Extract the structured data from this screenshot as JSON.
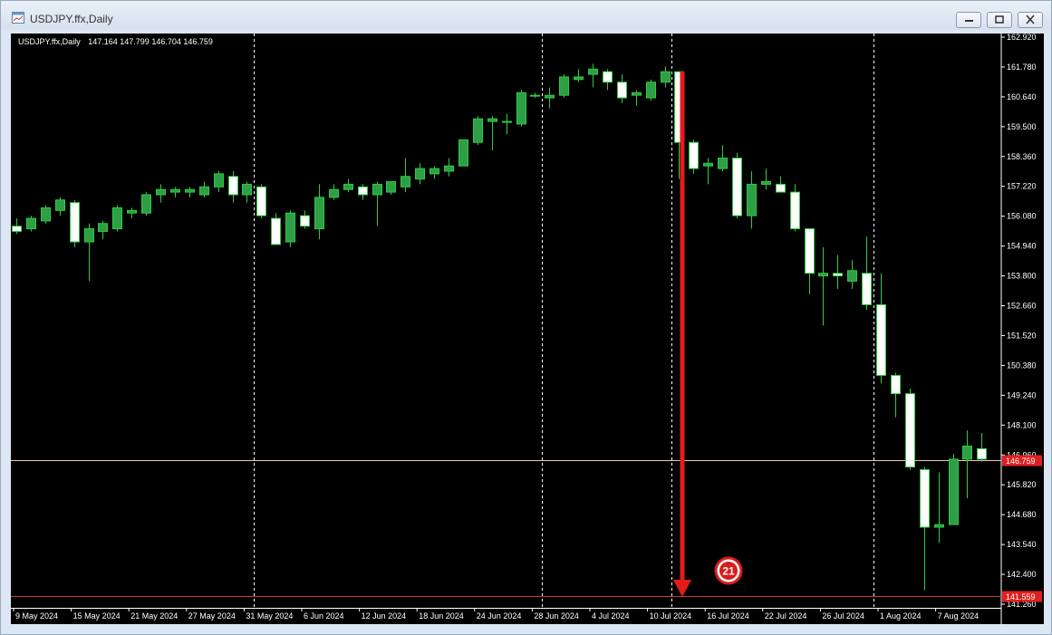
{
  "window": {
    "title": "USDJPY.ffx,Daily",
    "controls": {
      "minimize": "minimize",
      "restore": "restore",
      "close": "close"
    }
  },
  "chart_info": {
    "symbol": "USDJPY.ffx,Daily",
    "open": "147.164",
    "high": "147.799",
    "low": "146.704",
    "close": "146.759"
  },
  "price_labels": {
    "current_price": "146.759",
    "support_price": "141.559"
  },
  "annotation": {
    "badge": "21",
    "arrow_color": "#e31b1b"
  },
  "colors": {
    "background": "#000000",
    "bull_fill": "#2e9e47",
    "bear_fill": "#ffffff",
    "wick": "#2ecc40",
    "current_line": "#f5c1b6",
    "support_line": "#c43a2a",
    "price_tag": "#e02020"
  },
  "chart_data": {
    "type": "candlestick",
    "title": "",
    "xlabel": "",
    "ylabel": "",
    "ylim": [
      141.0,
      163.2
    ],
    "grid": false,
    "y_ticks": [
      "162.920",
      "161.780",
      "160.640",
      "159.500",
      "158.360",
      "157.220",
      "156.080",
      "154.940",
      "153.800",
      "152.660",
      "151.520",
      "150.380",
      "149.240",
      "148.100",
      "146.960",
      "145.820",
      "144.680",
      "143.540",
      "142.400",
      "141.260"
    ],
    "x_ticks": [
      "9 May 2024",
      "15 May 2024",
      "21 May 2024",
      "27 May 2024",
      "31 May 2024",
      "6 Jun 2024",
      "12 Jun 2024",
      "18 Jun 2024",
      "24 Jun 2024",
      "28 Jun 2024",
      "4 Jul 2024",
      "10 Jul 2024",
      "16 Jul 2024",
      "22 Jul 2024",
      "26 Jul 2024",
      "1 Aug 2024",
      "7 Aug 2024"
    ],
    "period_separators": [
      "31 May 2024",
      "28 Jun 2024",
      "10 Jul 2024",
      "1 Aug 2024"
    ],
    "horizontal_levels": [
      146.759,
      141.559
    ],
    "candles": [
      [
        155.7,
        156.0,
        155.4,
        155.5
      ],
      [
        155.6,
        156.1,
        155.5,
        156.0
      ],
      [
        155.9,
        156.5,
        155.8,
        156.4
      ],
      [
        156.3,
        156.8,
        156.1,
        156.7
      ],
      [
        156.6,
        156.7,
        154.9,
        155.1
      ],
      [
        155.1,
        155.8,
        153.6,
        155.6
      ],
      [
        155.5,
        155.9,
        155.2,
        155.8
      ],
      [
        155.6,
        156.5,
        155.5,
        156.4
      ],
      [
        156.2,
        156.4,
        156.0,
        156.3
      ],
      [
        156.2,
        157.0,
        156.1,
        156.9
      ],
      [
        156.9,
        157.3,
        156.6,
        157.1
      ],
      [
        157.0,
        157.2,
        156.8,
        157.1
      ],
      [
        157.0,
        157.2,
        156.8,
        157.1
      ],
      [
        156.9,
        157.4,
        156.8,
        157.2
      ],
      [
        157.2,
        157.8,
        157.0,
        157.7
      ],
      [
        157.6,
        157.8,
        156.6,
        156.9
      ],
      [
        156.9,
        157.4,
        156.6,
        157.3
      ],
      [
        157.2,
        157.3,
        156.0,
        156.1
      ],
      [
        156.0,
        156.2,
        155.0,
        155.0
      ],
      [
        155.1,
        156.3,
        154.9,
        156.2
      ],
      [
        156.1,
        156.3,
        155.6,
        155.7
      ],
      [
        155.6,
        157.3,
        155.2,
        156.8
      ],
      [
        156.8,
        157.3,
        156.7,
        157.1
      ],
      [
        157.1,
        157.5,
        157.0,
        157.3
      ],
      [
        157.2,
        157.3,
        156.7,
        156.9
      ],
      [
        156.9,
        157.4,
        155.7,
        157.3
      ],
      [
        157.0,
        157.4,
        156.9,
        157.4
      ],
      [
        157.2,
        158.3,
        157.0,
        157.6
      ],
      [
        157.5,
        158.1,
        157.3,
        157.9
      ],
      [
        157.7,
        158.0,
        157.5,
        157.9
      ],
      [
        157.8,
        158.3,
        157.6,
        158.0
      ],
      [
        158.0,
        159.0,
        158.0,
        159.0
      ],
      [
        158.9,
        159.9,
        158.8,
        159.8
      ],
      [
        159.7,
        159.9,
        158.6,
        159.8
      ],
      [
        159.7,
        160.0,
        159.2,
        159.7
      ],
      [
        159.6,
        160.9,
        159.5,
        160.8
      ],
      [
        160.7,
        160.8,
        160.6,
        160.7
      ],
      [
        160.6,
        161.0,
        160.2,
        160.7
      ],
      [
        160.7,
        161.5,
        160.6,
        161.4
      ],
      [
        161.3,
        161.7,
        161.2,
        161.4
      ],
      [
        161.5,
        161.9,
        161.0,
        161.7
      ],
      [
        161.6,
        161.7,
        160.9,
        161.2
      ],
      [
        161.2,
        161.5,
        160.4,
        160.6
      ],
      [
        160.7,
        160.9,
        160.3,
        160.8
      ],
      [
        160.6,
        161.3,
        160.5,
        161.2
      ],
      [
        161.2,
        161.8,
        161.0,
        161.6
      ],
      [
        161.6,
        161.6,
        157.5,
        158.9
      ],
      [
        158.9,
        159.0,
        157.7,
        157.9
      ],
      [
        158.0,
        158.3,
        157.3,
        158.1
      ],
      [
        157.9,
        158.8,
        157.8,
        158.3
      ],
      [
        158.3,
        158.5,
        156.0,
        156.1
      ],
      [
        156.1,
        157.8,
        155.6,
        157.3
      ],
      [
        157.3,
        157.9,
        157.1,
        157.4
      ],
      [
        157.3,
        157.6,
        157.0,
        157.0
      ],
      [
        157.0,
        157.3,
        155.5,
        155.6
      ],
      [
        155.6,
        155.6,
        153.1,
        153.9
      ],
      [
        153.8,
        154.9,
        151.9,
        153.9
      ],
      [
        153.9,
        154.6,
        153.3,
        153.8
      ],
      [
        153.6,
        154.4,
        153.3,
        154.0
      ],
      [
        153.9,
        155.3,
        152.5,
        152.7
      ],
      [
        152.7,
        153.9,
        149.7,
        150.0
      ],
      [
        150.0,
        150.1,
        148.4,
        149.3
      ],
      [
        149.3,
        149.5,
        146.4,
        146.5
      ],
      [
        146.4,
        146.5,
        141.8,
        144.2
      ],
      [
        144.2,
        146.3,
        143.6,
        144.3
      ],
      [
        144.3,
        147.0,
        145.1,
        146.8
      ],
      [
        146.8,
        147.9,
        145.3,
        147.3
      ],
      [
        147.2,
        147.8,
        146.7,
        146.8
      ]
    ]
  }
}
